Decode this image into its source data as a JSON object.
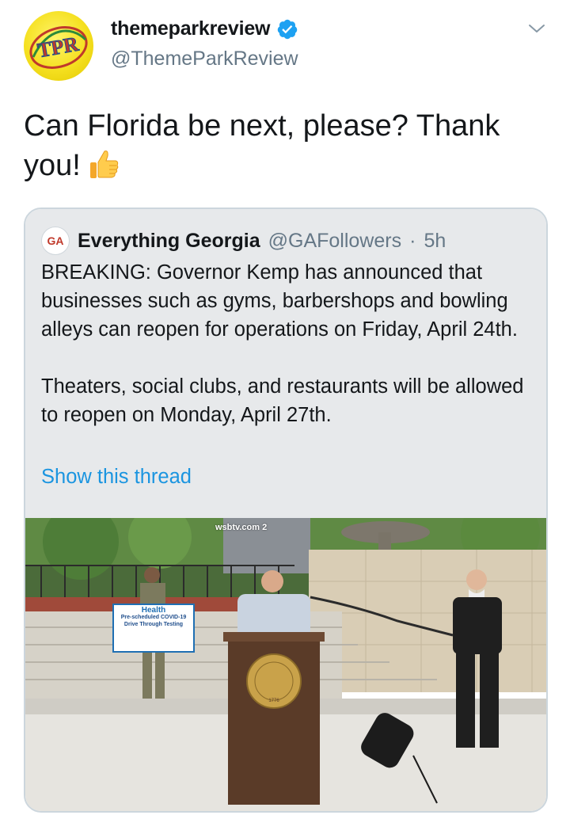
{
  "author": {
    "display_name": "themeparkreview",
    "handle": "@ThemeParkReview",
    "avatar_text": "TPR",
    "verified": true
  },
  "tweet": {
    "text": "Can Florida be next, please? Thank you!",
    "emoji": "thumbs-up"
  },
  "quoted_tweet": {
    "display_name": "Everything Georgia",
    "handle": "@GAFollowers",
    "separator": "·",
    "time": "5h",
    "logo_text": "GA",
    "paragraph_1": "BREAKING: Governor Kemp has announced that businesses such as gyms, barbershops and bowling alleys can reopen for operations on Friday, April 24th.",
    "paragraph_2": "Theaters, social clubs, and restaurants will be allowed to reopen on Monday, April 27th.",
    "show_thread": "Show this thread",
    "image": {
      "watermark": "wsbtv.com",
      "watermark_channel": "2",
      "sign_brand": "Health",
      "sign_line_1": "Pre-scheduled COVID-19",
      "sign_line_2": "Drive Through Testing",
      "seal_year": "1776"
    }
  },
  "colors": {
    "link": "#1b95e0",
    "secondary_text": "#657786",
    "verified": "#1da1f2",
    "quote_bg": "#e7e9eb",
    "border": "#ccd6dd"
  }
}
